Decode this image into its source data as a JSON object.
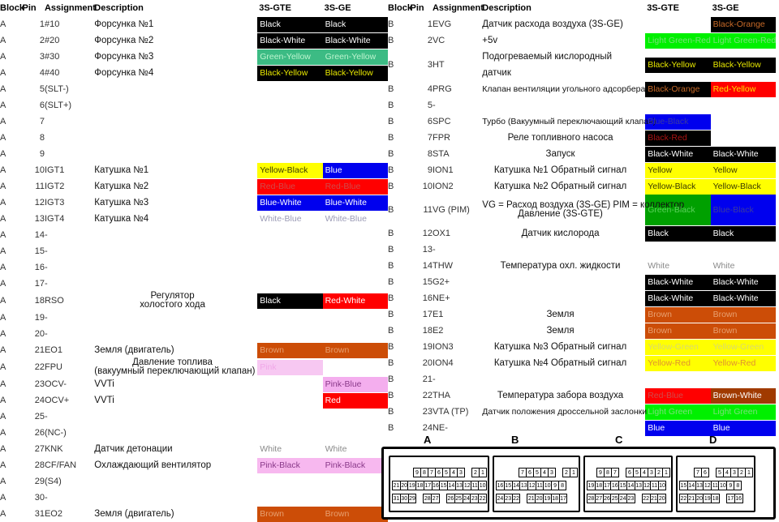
{
  "headers": {
    "block": "Block",
    "pin": "Pin",
    "assignment": "Assignment",
    "description": "Description",
    "col_gte": "3S-GTE",
    "col_ge": "3S-GE"
  },
  "palette": {
    "black": "#000000",
    "white_text": "#ffffff",
    "green_yellow_bg": "#3cbb84",
    "green_yellow_text": "#bdf5cf",
    "black_yellow_text": "#e8e800",
    "yellow_bg": "#ffff00",
    "yellow_text": "#3a3a00",
    "blue_bg": "#0000ee",
    "red_bg": "#ff0000",
    "brown_bg": "#cc4d07",
    "pink_bg": "#f7b8ef",
    "pink_light": "#f9c9f5",
    "green_bg": "#00a000",
    "light_green_bg": "#00f000",
    "brown_white_bg": "#a03a00",
    "white_bg": "#ffffff",
    "plain_text": "#777777"
  },
  "blockA": {
    "letter": "A",
    "rows": [
      {
        "pin": "1",
        "assign": "#10",
        "desc": "Форсунка №1",
        "desc_align": "left",
        "gte": {
          "t": "Black",
          "bg": "#000000",
          "fg": "#ffffff"
        },
        "ge": {
          "t": "Black",
          "bg": "#000000",
          "fg": "#ffffff"
        }
      },
      {
        "pin": "2",
        "assign": "#20",
        "desc": "Форсунка №2",
        "desc_align": "left",
        "gte": {
          "t": "Black-White",
          "bg": "#000000",
          "fg": "#ffffff"
        },
        "ge": {
          "t": "Black-White",
          "bg": "#000000",
          "fg": "#ffffff"
        }
      },
      {
        "pin": "3",
        "assign": "#30",
        "desc": "Форсунка №3",
        "desc_align": "left",
        "gte": {
          "t": "Green-Yellow",
          "bg": "#3cbb84",
          "fg": "#bdf5cf"
        },
        "ge": {
          "t": "Green-Yellow",
          "bg": "#3cbb84",
          "fg": "#bdf5cf"
        }
      },
      {
        "pin": "4",
        "assign": "#40",
        "desc": "Форсунка №4",
        "desc_align": "left",
        "gte": {
          "t": "Black-Yellow",
          "bg": "#000000",
          "fg": "#e8e800"
        },
        "ge": {
          "t": "Black-Yellow",
          "bg": "#000000",
          "fg": "#e8e800"
        }
      },
      {
        "pin": "5",
        "assign": "(SLT-)",
        "desc": "",
        "desc_align": "left",
        "gte": null,
        "ge": null
      },
      {
        "pin": "6",
        "assign": "(SLT+)",
        "desc": "",
        "desc_align": "left",
        "gte": null,
        "ge": null
      },
      {
        "pin": "7",
        "assign": "",
        "desc": "",
        "desc_align": "left",
        "gte": null,
        "ge": null
      },
      {
        "pin": "8",
        "assign": "",
        "desc": "",
        "desc_align": "left",
        "gte": null,
        "ge": null
      },
      {
        "pin": "9",
        "assign": "",
        "desc": "",
        "desc_align": "left",
        "gte": null,
        "ge": null
      },
      {
        "pin": "10",
        "assign": "IGT1",
        "desc": "Катушка №1",
        "desc_align": "left",
        "gte": {
          "t": "Yellow-Black",
          "bg": "#ffff00",
          "fg": "#3a3a00"
        },
        "ge": {
          "t": "Blue",
          "bg": "#0000ee",
          "fg": "#ffffff"
        }
      },
      {
        "pin": "11",
        "assign": "IGT2",
        "desc": "Катушка №2",
        "desc_align": "left",
        "gte": {
          "t": "Red-Blue",
          "bg": "#ff0000",
          "fg": "#d14a4a"
        },
        "ge": {
          "t": "Red-Blue",
          "bg": "#ff0000",
          "fg": "#d14a4a"
        }
      },
      {
        "pin": "12",
        "assign": "IGT3",
        "desc": "Катушка №3",
        "desc_align": "left",
        "gte": {
          "t": "Blue-White",
          "bg": "#0000ee",
          "fg": "#ffffff"
        },
        "ge": {
          "t": "Blue-White",
          "bg": "#0000ee",
          "fg": "#ffffff"
        }
      },
      {
        "pin": "13",
        "assign": "IGT4",
        "desc": "Катушка №4",
        "desc_align": "left",
        "gte": {
          "t": "White-Blue",
          "bg": "transparent",
          "fg": "#9a9ab5"
        },
        "ge": {
          "t": "White-Blue",
          "bg": "transparent",
          "fg": "#9a9ab5"
        }
      },
      {
        "pin": "14",
        "assign": "-",
        "desc": "",
        "desc_align": "left",
        "gte": null,
        "ge": null
      },
      {
        "pin": "15",
        "assign": "-",
        "desc": "",
        "desc_align": "left",
        "gte": null,
        "ge": null
      },
      {
        "pin": "16",
        "assign": "-",
        "desc": "",
        "desc_align": "left",
        "gte": null,
        "ge": null
      },
      {
        "pin": "17",
        "assign": "-",
        "desc": "",
        "desc_align": "left",
        "gte": null,
        "ge": null
      },
      {
        "pin": "18",
        "assign": "RSO",
        "desc": "Регулятор",
        "desc2": "холостого хода",
        "desc_align": "center",
        "gte": {
          "t": "Black",
          "bg": "#000000",
          "fg": "#ffffff"
        },
        "ge": {
          "t": "Red-White",
          "bg": "#ff0000",
          "fg": "#ffffff"
        }
      },
      {
        "pin": "19",
        "assign": "-",
        "desc": "",
        "desc_align": "left",
        "gte": null,
        "ge": null
      },
      {
        "pin": "20",
        "assign": "-",
        "desc": "",
        "desc_align": "left",
        "gte": null,
        "ge": null
      },
      {
        "pin": "21",
        "assign": "EO1",
        "desc": "Земля (двигатель)",
        "desc_align": "left",
        "gte": {
          "t": "Brown",
          "bg": "#cc4d07",
          "fg": "#e8a070"
        },
        "ge": {
          "t": "Brown",
          "bg": "#cc4d07",
          "fg": "#e8a070"
        }
      },
      {
        "pin": "22",
        "assign": "FPU",
        "desc": "Давление топлива",
        "desc2": "(вакуумный переключающий клапан)",
        "desc_align": "center",
        "gte": {
          "t": "Pink",
          "bg": "#f7c8f2",
          "fg": "#f0a8e8"
        },
        "ge": null
      },
      {
        "pin": "23",
        "assign": "OCV-",
        "desc": "VVTi",
        "desc_align": "left",
        "gte": null,
        "ge": {
          "t": "Pink-Blue",
          "bg": "#f4aeee",
          "fg": "#8a3a8a"
        }
      },
      {
        "pin": "24",
        "assign": "OCV+",
        "desc": "VVTi",
        "desc_align": "left",
        "gte": null,
        "ge": {
          "t": "Red",
          "bg": "#ff0000",
          "fg": "#ffffff"
        }
      },
      {
        "pin": "25",
        "assign": "-",
        "desc": "",
        "desc_align": "left",
        "gte": null,
        "ge": null
      },
      {
        "pin": "26",
        "assign": "(NC-)",
        "desc": "",
        "desc_align": "left",
        "gte": null,
        "ge": null
      },
      {
        "pin": "27",
        "assign": "KNK",
        "desc": "Датчик детонации",
        "desc_align": "left",
        "gte": {
          "t": "White",
          "bg": "transparent",
          "fg": "#8a8a8a"
        },
        "ge": {
          "t": "White",
          "bg": "transparent",
          "fg": "#8a8a8a"
        }
      },
      {
        "pin": "28",
        "assign": "CF/FAN",
        "desc": "Охлаждающий вентилятор",
        "desc_align": "left",
        "gte": {
          "t": "Pink-Black",
          "bg": "#f7b8ef",
          "fg": "#8a3a8a"
        },
        "ge": {
          "t": "Pink-Black",
          "bg": "#f7b8ef",
          "fg": "#8a3a8a"
        }
      },
      {
        "pin": "29",
        "assign": "(S4)",
        "desc": "",
        "desc_align": "left",
        "gte": null,
        "ge": null
      },
      {
        "pin": "30",
        "assign": "-",
        "desc": "",
        "desc_align": "left",
        "gte": null,
        "ge": null
      },
      {
        "pin": "31",
        "assign": "EO2",
        "desc": "Земля (двигатель)",
        "desc_align": "left",
        "gte": {
          "t": "Brown",
          "bg": "#cc4d07",
          "fg": "#e8a070"
        },
        "ge": {
          "t": "Brown",
          "bg": "#cc4d07",
          "fg": "#e8a070"
        }
      }
    ]
  },
  "blockB": {
    "letter": "B",
    "rows": [
      {
        "pin": "1",
        "assign": "EVG",
        "desc": "Датчик расхода воздуха (3S-GE)",
        "desc_align": "left",
        "gte": null,
        "ge": {
          "t": "Black-Orange",
          "bg": "#000000",
          "fg": "#c86a28"
        }
      },
      {
        "pin": "2",
        "assign": "VC",
        "desc": "+5v",
        "desc_align": "left",
        "gte": {
          "t": "Light Green-Red",
          "bg": "#00f000",
          "fg": "#7ae07a"
        },
        "ge": {
          "t": "Light Green-Red",
          "bg": "#00f000",
          "fg": "#7ae07a"
        }
      },
      {
        "pin": "3",
        "assign": "HT",
        "desc": "Подогреваемый кислородный датчик",
        "desc_align": "left",
        "gte": {
          "t": "Black-Yellow",
          "bg": "#000000",
          "fg": "#e8e800"
        },
        "ge": {
          "t": "Black-Yellow",
          "bg": "#000000",
          "fg": "#e8e800"
        }
      },
      {
        "pin": "4",
        "assign": "PRG",
        "desc": "Клапан вентиляции угольного адсорбера",
        "desc_align": "left",
        "gte": {
          "t": "Black-Orange",
          "bg": "#000000",
          "fg": "#c86a28"
        },
        "ge": {
          "t": "Red-Yellow",
          "bg": "#ff0000",
          "fg": "#ffe000"
        }
      },
      {
        "pin": "5",
        "assign": "-",
        "desc": "",
        "desc_align": "left",
        "gte": null,
        "ge": null
      },
      {
        "pin": "6",
        "assign": "SPC",
        "desc": "Турбо (Вакуумный переключающий клапан)",
        "desc_align": "center",
        "gte": {
          "t": "Blue-Black",
          "bg": "#0000ee",
          "fg": "#3a3aa0"
        },
        "ge": null
      },
      {
        "pin": "7",
        "assign": "FPR",
        "desc": "Реле топливного насоса",
        "desc_align": "center",
        "gte": {
          "t": "Black-Red",
          "bg": "#000000",
          "fg": "#aa1414"
        },
        "ge": null
      },
      {
        "pin": "8",
        "assign": "STA",
        "desc": "Запуск",
        "desc_align": "center",
        "gte": {
          "t": "Black-White",
          "bg": "#000000",
          "fg": "#ffffff"
        },
        "ge": {
          "t": "Black-White",
          "bg": "#000000",
          "fg": "#ffffff"
        }
      },
      {
        "pin": "9",
        "assign": "ION1",
        "desc": "Катушка №1 Обратный сигнал",
        "desc_align": "center",
        "gte": {
          "t": "Yellow",
          "bg": "#ffff00",
          "fg": "#3a3a00"
        },
        "ge": {
          "t": "Yellow",
          "bg": "#ffff00",
          "fg": "#3a3a00"
        }
      },
      {
        "pin": "10",
        "assign": "ION2",
        "desc": "Катушка №2 Обратный сигнал",
        "desc_align": "center",
        "gte": {
          "t": "Yellow-Black",
          "bg": "#ffff00",
          "fg": "#3a3a00"
        },
        "ge": {
          "t": "Yellow-Black",
          "bg": "#ffff00",
          "fg": "#3a3a00"
        }
      },
      {
        "pin": "11",
        "assign": "VG (PIM)",
        "desc": "VG = Расход воздуха (3S-GE) PIM = коллектор",
        "desc2": "Давление (3S-GTE)",
        "desc_align": "center",
        "gte": {
          "t": "Green-Black",
          "bg": "#00a000",
          "fg": "#5ad05a"
        },
        "ge": {
          "t": "Blue-Black",
          "bg": "#0000ee",
          "fg": "#3a3aa0"
        },
        "tall": true
      },
      {
        "pin": "12",
        "assign": "OX1",
        "desc": "Датчик кислорода",
        "desc_align": "center",
        "gte": {
          "t": "Black",
          "bg": "#000000",
          "fg": "#ffffff"
        },
        "ge": {
          "t": "Black",
          "bg": "#000000",
          "fg": "#ffffff"
        }
      },
      {
        "pin": "13",
        "assign": "-",
        "desc": "",
        "desc_align": "left",
        "gte": null,
        "ge": null
      },
      {
        "pin": "14",
        "assign": "THW",
        "desc": "Температура охл. жидкости",
        "desc_align": "center",
        "gte": {
          "t": "White",
          "bg": "transparent",
          "fg": "#8a8a8a"
        },
        "ge": {
          "t": "White",
          "bg": "transparent",
          "fg": "#8a8a8a"
        }
      },
      {
        "pin": "15",
        "assign": "G2+",
        "desc": "",
        "desc_align": "left",
        "gte": {
          "t": "Black-White",
          "bg": "#000000",
          "fg": "#ffffff"
        },
        "ge": {
          "t": "Black-White",
          "bg": "#000000",
          "fg": "#ffffff"
        }
      },
      {
        "pin": "16",
        "assign": "NE+",
        "desc": "",
        "desc_align": "left",
        "gte": {
          "t": "Black-White",
          "bg": "#000000",
          "fg": "#ffffff"
        },
        "ge": {
          "t": "Black-White",
          "bg": "#000000",
          "fg": "#ffffff"
        }
      },
      {
        "pin": "17",
        "assign": "E1",
        "desc": "Земля",
        "desc_align": "center",
        "gte": {
          "t": "Brown",
          "bg": "#cc4d07",
          "fg": "#e8a070"
        },
        "ge": {
          "t": "Brown",
          "bg": "#cc4d07",
          "fg": "#e8a070"
        }
      },
      {
        "pin": "18",
        "assign": "E2",
        "desc": "Земля",
        "desc_align": "center",
        "gte": {
          "t": "Brown",
          "bg": "#cc4d07",
          "fg": "#e8a070"
        },
        "ge": {
          "t": "Brown",
          "bg": "#cc4d07",
          "fg": "#e8a070"
        }
      },
      {
        "pin": "19",
        "assign": "ION3",
        "desc": "Катушка №3 Обратный сигнал",
        "desc_align": "center",
        "gte": {
          "t": "Yellow-Green",
          "bg": "#ffff00",
          "fg": "#d8d870"
        },
        "ge": {
          "t": "Yellow-Green",
          "bg": "#ffff00",
          "fg": "#d8d870"
        }
      },
      {
        "pin": "20",
        "assign": "ION4",
        "desc": "Катушка №4 Обратный сигнал",
        "desc_align": "center",
        "gte": {
          "t": "Yellow-Red",
          "bg": "#ffff00",
          "fg": "#e09030"
        },
        "ge": {
          "t": "Yellow-Red",
          "bg": "#ffff00",
          "fg": "#e09030"
        }
      },
      {
        "pin": "21",
        "assign": "-",
        "desc": "",
        "desc_align": "left",
        "gte": null,
        "ge": null
      },
      {
        "pin": "22",
        "assign": "THA",
        "desc": "Температура забора воздуха",
        "desc_align": "center",
        "gte": {
          "t": "Red-Blue",
          "bg": "#ff0000",
          "fg": "#d14a4a"
        },
        "ge": {
          "t": "Brown-White",
          "bg": "#a03a00",
          "fg": "#ffffff"
        }
      },
      {
        "pin": "23",
        "assign": "VTA (TP)",
        "desc": "Датчик положения дроссельной заслонки",
        "desc_align": "center",
        "gte": {
          "t": "Light Green",
          "bg": "#00f000",
          "fg": "#7ae07a"
        },
        "ge": {
          "t": "Light Green",
          "bg": "#00f000",
          "fg": "#7ae07a"
        }
      },
      {
        "pin": "24",
        "assign": "NE-",
        "desc": "",
        "desc_align": "left",
        "gte": {
          "t": "Blue",
          "bg": "#0000ee",
          "fg": "#ffffff"
        },
        "ge": {
          "t": "Blue",
          "bg": "#0000ee",
          "fg": "#ffffff"
        }
      }
    ]
  },
  "connectors": {
    "labels": [
      "A",
      "B",
      "C",
      "D"
    ],
    "A": {
      "label": "A",
      "row1": [
        "9",
        "8",
        "7",
        "6",
        "5",
        "4",
        "3",
        "|",
        "2",
        "1"
      ],
      "row2": [
        "21",
        "20",
        "19",
        "18",
        "17",
        "16",
        "15",
        "14",
        "13",
        "12",
        "11",
        "10"
      ],
      "row3": [
        "31",
        "30",
        "29",
        "|",
        "28",
        "27",
        "|",
        "26",
        "25",
        "24",
        "23",
        "22"
      ]
    },
    "B": {
      "label": "B",
      "row1": [
        "7",
        "6",
        "5",
        "4",
        "3",
        "|",
        "2",
        "1"
      ],
      "row2": [
        "16",
        "15",
        "14",
        "13",
        "12",
        "11",
        "10",
        "9",
        "8"
      ],
      "row3": [
        "24",
        "23",
        "22",
        "|",
        "21",
        "20",
        "19",
        "18",
        "17"
      ]
    },
    "C": {
      "label": "C",
      "row1": [
        "9",
        "8",
        "7",
        "|",
        "6",
        "5",
        "4",
        "3",
        "2",
        "1"
      ],
      "row2": [
        "19",
        "18",
        "17",
        "16",
        "15",
        "14",
        "13",
        "12",
        "11",
        "10"
      ],
      "row3": [
        "28",
        "27",
        "26",
        "25",
        "24",
        "23",
        "|",
        "22",
        "21",
        "20"
      ]
    },
    "D": {
      "label": "D",
      "row1": [
        "7",
        "6",
        "|",
        "5",
        "4",
        "3",
        "2",
        "1"
      ],
      "row2": [
        "15",
        "14",
        "13",
        "12",
        "11",
        "10",
        "9",
        "8"
      ],
      "row3": [
        "22",
        "21",
        "20",
        "19",
        "18",
        "|",
        "17",
        "16"
      ]
    }
  }
}
